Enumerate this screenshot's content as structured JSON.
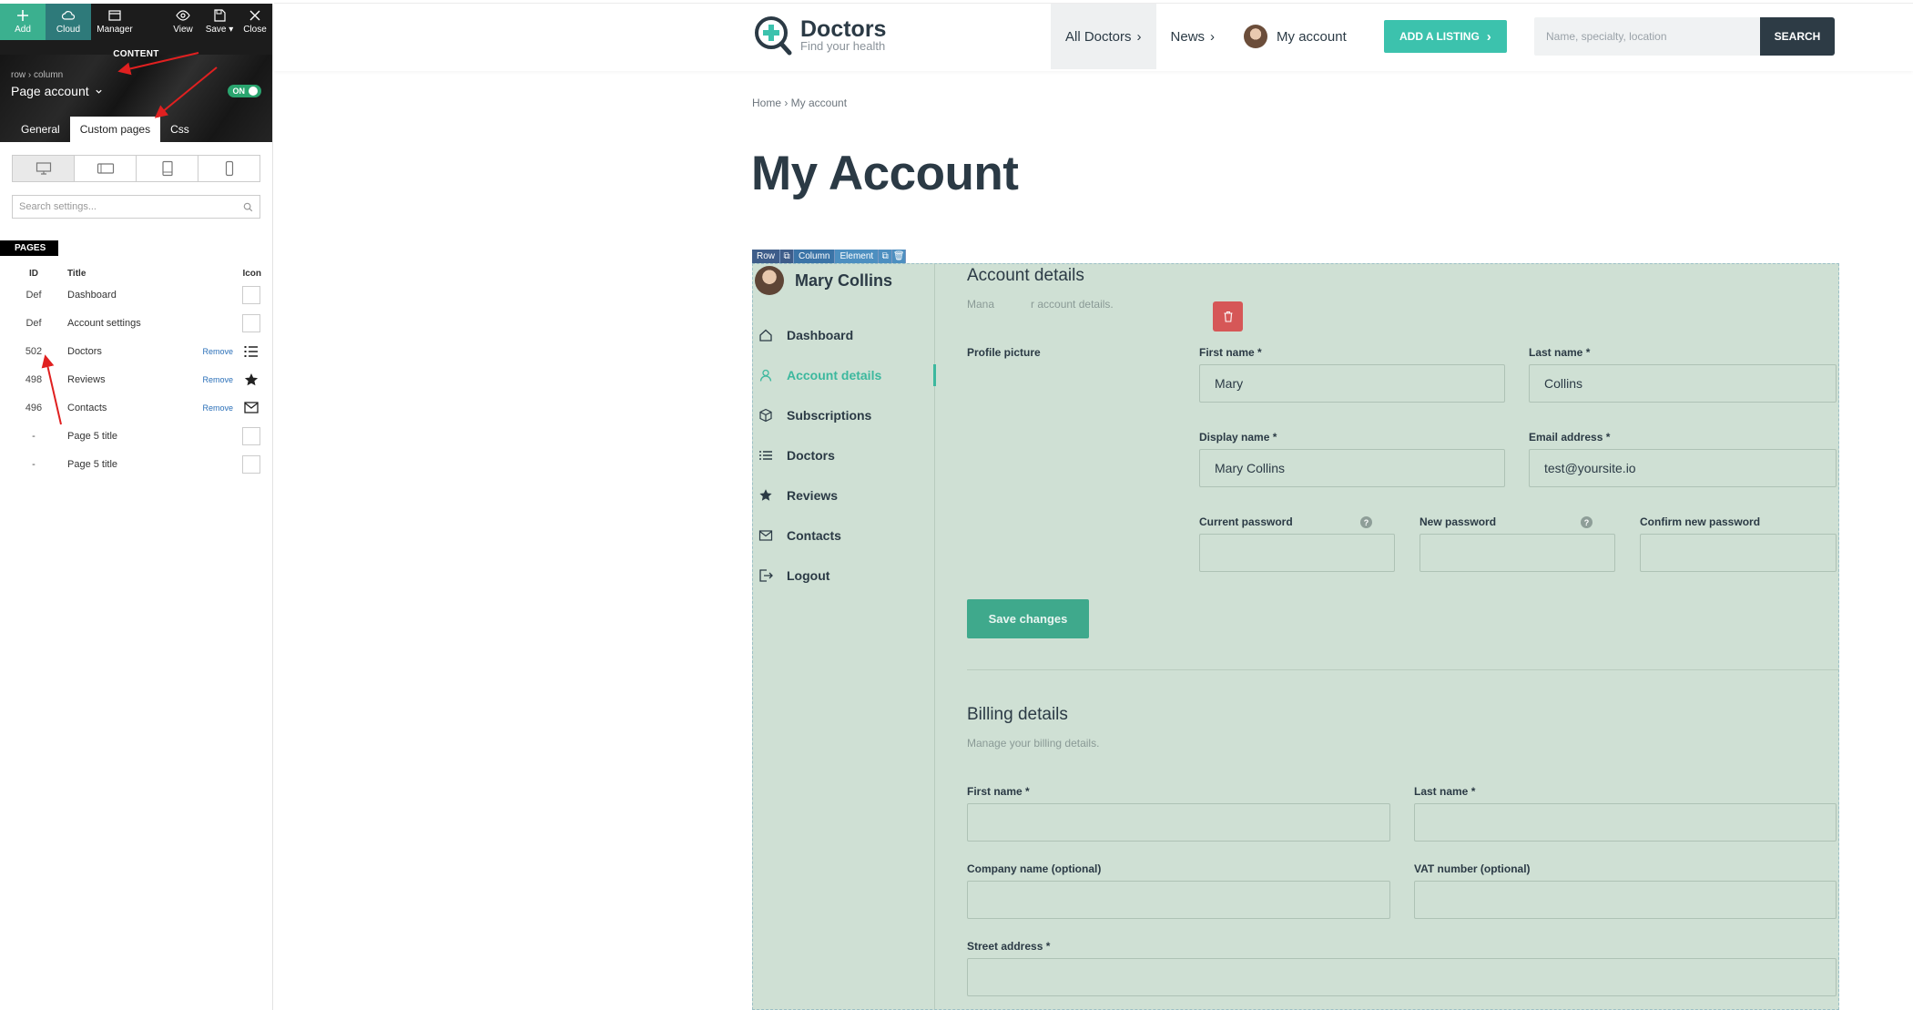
{
  "editor": {
    "tools": {
      "add": "Add",
      "cloud": "Cloud",
      "manager": "Manager",
      "view": "View",
      "save": "Save",
      "close": "Close"
    },
    "content_label": "CONTENT",
    "breadcrumb": "row  ›  column",
    "page_title": "Page account",
    "toggle": "ON",
    "tabs": [
      "General",
      "Custom pages",
      "Css"
    ],
    "active_tab": "Custom pages",
    "search_placeholder": "Search settings...",
    "pages_label": "PAGES",
    "columns": {
      "id": "ID",
      "title": "Title",
      "icon": "Icon"
    },
    "remove_label": "Remove",
    "pages": [
      {
        "id": "Def",
        "title": "Dashboard",
        "removable": false,
        "icon": "empty"
      },
      {
        "id": "Def",
        "title": "Account settings",
        "removable": false,
        "icon": "empty"
      },
      {
        "id": "502",
        "title": "Doctors",
        "removable": true,
        "icon": "list-icon"
      },
      {
        "id": "498",
        "title": "Reviews",
        "removable": true,
        "icon": "star-icon"
      },
      {
        "id": "496",
        "title": "Contacts",
        "removable": true,
        "icon": "envelope-icon"
      },
      {
        "id": "-",
        "title": "Page 5 title",
        "removable": false,
        "icon": "empty"
      },
      {
        "id": "-",
        "title": "Page 5 title",
        "removable": false,
        "icon": "empty"
      }
    ]
  },
  "site": {
    "logo": {
      "name": "Doctors",
      "tagline": "Find your health"
    },
    "nav": {
      "all_doctors": "All Doctors",
      "news": "News",
      "my_account": "My account"
    },
    "add_listing": "ADD A LISTING",
    "search_placeholder": "Name, specialty, location",
    "search_button": "SEARCH",
    "breadcrumb": "Home  ›  My account",
    "title": "My Account",
    "editbar": {
      "row": "Row",
      "column": "Column",
      "element": "Element"
    },
    "account": {
      "user_name": "Mary Collins",
      "menu": [
        "Dashboard",
        "Account details",
        "Subscriptions",
        "Doctors",
        "Reviews",
        "Contacts",
        "Logout"
      ],
      "active_menu": "Account details",
      "details": {
        "title": "Account details",
        "subtitle_visible_start": "Mana",
        "subtitle_visible_end": "r account details.",
        "profile_picture": "Profile picture",
        "first_name_label": "First name *",
        "first_name": "Mary",
        "last_name_label": "Last name *",
        "last_name": "Collins",
        "display_name_label": "Display name *",
        "display_name": "Mary Collins",
        "email_label": "Email address *",
        "email": "test@yoursite.io",
        "current_password": "Current password",
        "new_password": "New password",
        "confirm_password": "Confirm new password",
        "help": "?",
        "save": "Save changes"
      },
      "billing": {
        "title": "Billing details",
        "subtitle": "Manage your billing details.",
        "first_name_label": "First name *",
        "last_name_label": "Last name *",
        "company_label": "Company name (optional)",
        "vat_label": "VAT number (optional)",
        "street_label": "Street address *"
      }
    }
  },
  "colors": {
    "accent": "#3cc2ad",
    "dark": "#2b3a45",
    "panel_bg": "#cfe0d4",
    "arrow": "#e02020"
  }
}
